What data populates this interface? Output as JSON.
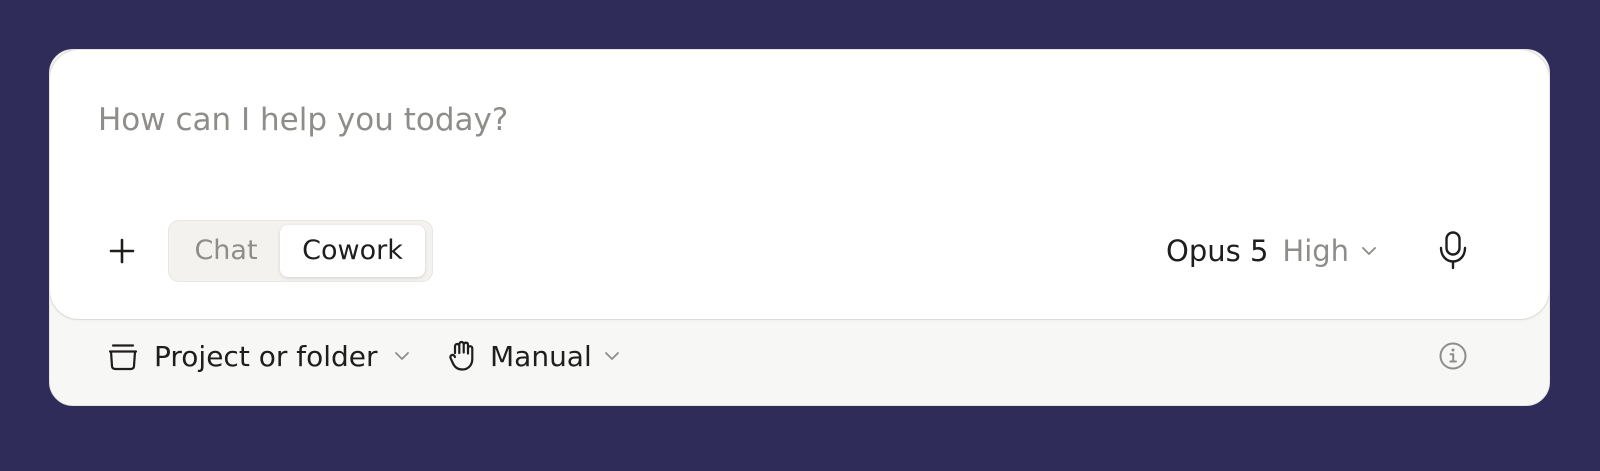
{
  "composer": {
    "placeholder": "How can I help you today?",
    "value": "",
    "add_icon": "plus-icon",
    "mic_icon": "microphone-icon"
  },
  "mode_toggle": {
    "tabs": [
      {
        "label": "Chat",
        "selected": false
      },
      {
        "label": "Cowork",
        "selected": true
      }
    ]
  },
  "model_selector": {
    "model": "Opus 5",
    "effort": "High",
    "chevron_icon": "chevron-down-icon"
  },
  "footer": {
    "project": {
      "label": "Project or folder",
      "icon": "folder-icon",
      "chevron_icon": "chevron-down-icon"
    },
    "permission": {
      "label": "Manual",
      "icon": "hand-icon",
      "chevron_icon": "chevron-down-icon"
    },
    "info_icon": "info-icon"
  },
  "colors": {
    "background": "#2f2c5a",
    "card": "#ffffff",
    "footer": "#f7f7f6",
    "text_primary": "#1f1e1d",
    "text_muted": "#8e8d89"
  }
}
